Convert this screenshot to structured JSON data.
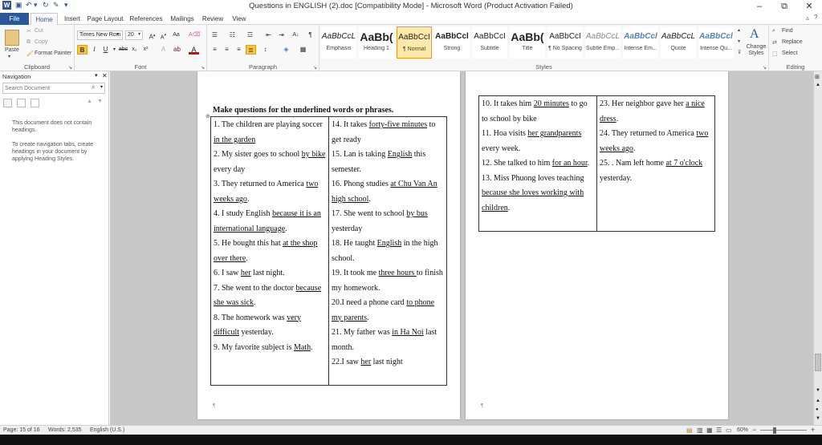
{
  "window": {
    "title": "Questions in ENGLISH (2).doc [Compatibility Mode] - Microsoft Word (Product Activation Failed)"
  },
  "tabs": [
    {
      "label": "File"
    },
    {
      "label": "Home"
    },
    {
      "label": "Insert"
    },
    {
      "label": "Page Layout"
    },
    {
      "label": "References"
    },
    {
      "label": "Mailings"
    },
    {
      "label": "Review"
    },
    {
      "label": "View"
    }
  ],
  "ribbon": {
    "clipboard": {
      "paste": "Paste",
      "cut": "Cut",
      "copy": "Copy",
      "format_painter": "Format Painter",
      "label": "Clipboard"
    },
    "font": {
      "name": "Times New Rom",
      "size": "20",
      "label": "Font"
    },
    "paragraph": {
      "label": "Paragraph"
    },
    "styles": {
      "label": "Styles",
      "change_styles": "Change Styles",
      "items": [
        {
          "preview": "AaBbCcL",
          "name": "Emphasis"
        },
        {
          "preview": "AaBb(",
          "name": "Heading 1"
        },
        {
          "preview": "AaBbCcI",
          "name": "¶ Normal"
        },
        {
          "preview": "AaBbCcl",
          "name": "Strong"
        },
        {
          "preview": "AaBbCcI",
          "name": "Subtitle"
        },
        {
          "preview": "AaBb(",
          "name": "Title"
        },
        {
          "preview": "AaBbCcI",
          "name": "¶ No Spacing"
        },
        {
          "preview": "AaBbCcL",
          "name": "Subtle Emp..."
        },
        {
          "preview": "AaBbCcl",
          "name": "Intense Em..."
        },
        {
          "preview": "AaBbCcL",
          "name": "Quote"
        },
        {
          "preview": "AaBbCcl",
          "name": "Intense Qu..."
        }
      ]
    },
    "editing": {
      "find": "Find",
      "replace": "Replace",
      "select": "Select",
      "label": "Editing"
    }
  },
  "nav": {
    "title": "Navigation",
    "search_placeholder": "Search Document",
    "msg1": "This document does not contain headings.",
    "msg2": "To create navigation tabs, create headings in your document by applying Heading Styles."
  },
  "doc": {
    "heading": "Make questions for the underlined words or phrases.",
    "left_col": [
      [
        {
          "t": "1.  The children are playing soccer "
        },
        {
          "t": "in the garden",
          "u": true
        }
      ],
      [
        {
          "t": "2.  My sister goes to school "
        },
        {
          "t": "by bike",
          "u": true
        },
        {
          "t": " every day"
        }
      ],
      [
        {
          "t": "3.  They returned to America "
        },
        {
          "t": "two weeks ago",
          "u": true
        },
        {
          "t": "."
        }
      ],
      [
        {
          "t": "4.  I study English "
        },
        {
          "t": "because it is an international language",
          "u": true
        },
        {
          "t": "."
        }
      ],
      [
        {
          "t": "5.  He bought this hat "
        },
        {
          "t": "at the shop over there",
          "u": true
        },
        {
          "t": "."
        }
      ],
      [
        {
          "t": "6.  I saw "
        },
        {
          "t": "her",
          "u": true
        },
        {
          "t": " last night."
        }
      ],
      [
        {
          "t": "7.  She went to the doctor "
        },
        {
          "t": "because she was sick",
          "u": true
        },
        {
          "t": "."
        }
      ],
      [
        {
          "t": "8.  The homework was "
        },
        {
          "t": "very difficult",
          "u": true
        },
        {
          "t": " yesterday."
        }
      ],
      [
        {
          "t": "9.   My favorite subject is "
        },
        {
          "t": "Math",
          "u": true
        },
        {
          "t": "."
        }
      ]
    ],
    "mid_col": [
      [
        {
          "t": "14. It takes "
        },
        {
          "t": "forty-five minutes",
          "u": true
        },
        {
          "t": " to get ready"
        }
      ],
      [
        {
          "t": "15. Lan is taking "
        },
        {
          "t": "English",
          "u": true
        },
        {
          "t": " this semester."
        }
      ],
      [
        {
          "t": "16. Phong studies "
        },
        {
          "t": "at Chu Van An high school",
          "u": true
        },
        {
          "t": "."
        }
      ],
      [
        {
          "t": "17. She went to school "
        },
        {
          "t": "by bus",
          "u": true
        },
        {
          "t": " yesterday"
        }
      ],
      [
        {
          "t": "18. He taught "
        },
        {
          "t": "English",
          "u": true
        },
        {
          "t": " in the high school."
        }
      ],
      [
        {
          "t": "19. It took me "
        },
        {
          "t": "three hours ",
          "u": true
        },
        {
          "t": "to finish my homework."
        }
      ],
      [
        {
          "t": "20.I need a phone card "
        },
        {
          "t": "to phone my parents",
          "u": true
        },
        {
          "t": "."
        }
      ],
      [
        {
          "t": "21. My father was "
        },
        {
          "t": "in Ha Noi",
          "u": true
        },
        {
          "t": " last month."
        }
      ],
      [
        {
          "t": "22.I saw "
        },
        {
          "t": "her",
          "u": true
        },
        {
          "t": " last night"
        }
      ]
    ],
    "p2_left": [
      [
        {
          "t": "10. It takes him "
        },
        {
          "t": "20 minutes",
          "u": true
        },
        {
          "t": " to go to school by bike"
        }
      ],
      [
        {
          "t": "11. Hoa visits "
        },
        {
          "t": "her grandparents",
          "u": true
        },
        {
          "t": " every week."
        }
      ],
      [
        {
          "t": "12. She talked to him "
        },
        {
          "t": "for an hour",
          "u": true
        },
        {
          "t": "."
        }
      ],
      [
        {
          "t": "13. Miss Phuong loves teaching "
        },
        {
          "t": "because she loves working with children",
          "u": true
        },
        {
          "t": "."
        }
      ]
    ],
    "p2_right": [
      [
        {
          "t": "23. Her neighbor gave her "
        },
        {
          "t": "a nice dress",
          "u": true
        },
        {
          "t": "."
        }
      ],
      [
        {
          "t": "24. They returned to America "
        },
        {
          "t": "two weeks ago",
          "u": true
        },
        {
          "t": "."
        }
      ],
      [
        {
          "t": "25. . Nam left home "
        },
        {
          "t": "at 7 o'clock",
          "u": true
        },
        {
          "t": " yesterday."
        }
      ]
    ]
  },
  "status": {
    "page": "Page: 15 of 16",
    "words": "Words: 2,535",
    "lang": "English (U.S.)",
    "zoom": "60%"
  }
}
